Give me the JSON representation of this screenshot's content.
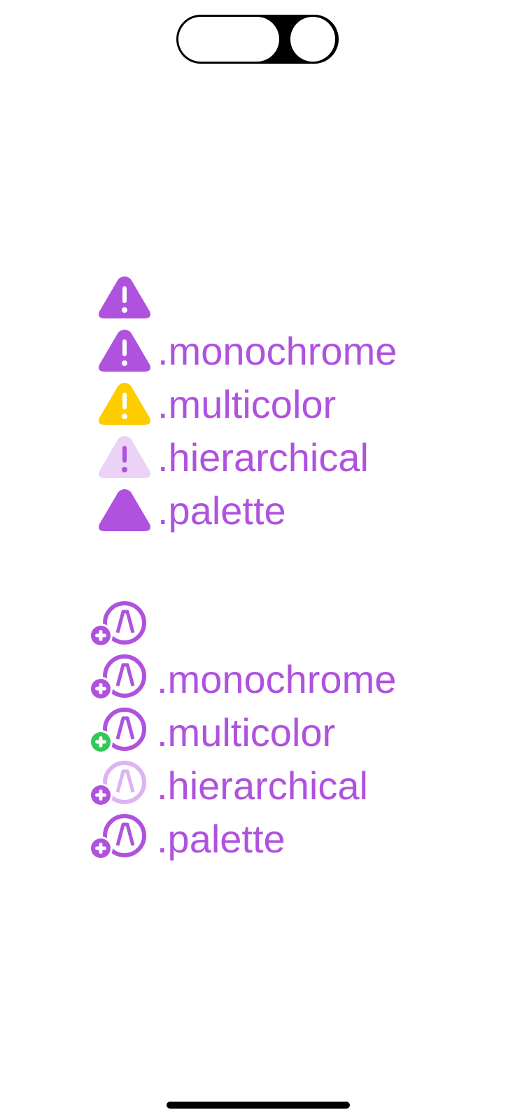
{
  "colors": {
    "accent": "#af52de",
    "accent_light": "#ead3f6",
    "multicolor_warning": "#ffcc00",
    "multicolor_plus": "#34c759",
    "hierarchical_secondary": "#ddb3f2"
  },
  "warning_section": {
    "icon": "exclamationmark-triangle-icon",
    "rows": [
      {
        "label": ""
      },
      {
        "label": ".monochrome"
      },
      {
        "label": ".multicolor"
      },
      {
        "label": ".hierarchical"
      },
      {
        "label": ".palette"
      }
    ]
  },
  "account_section": {
    "icon": "person-crop-circle-badge-plus-icon",
    "rows": [
      {
        "label": ""
      },
      {
        "label": ".monochrome"
      },
      {
        "label": ".multicolor"
      },
      {
        "label": ".hierarchical"
      },
      {
        "label": ".palette"
      }
    ]
  }
}
